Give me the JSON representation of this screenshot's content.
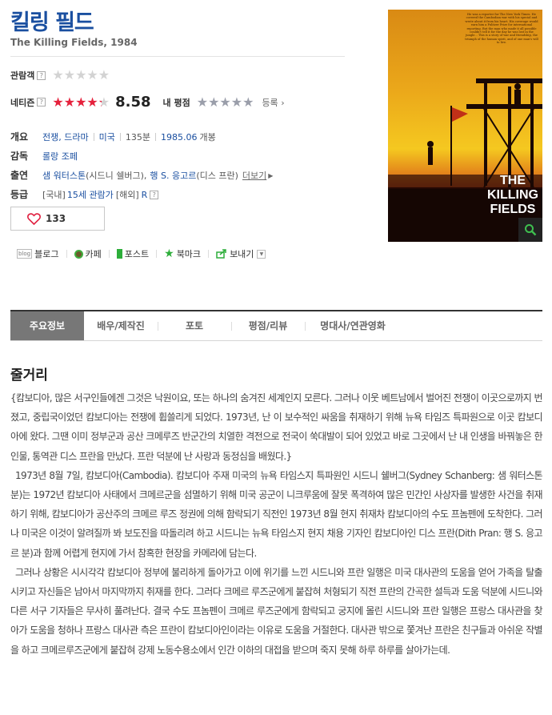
{
  "movie": {
    "title": "킬링 필드",
    "subtitle": "The Killing Fields, 1984"
  },
  "ratings": {
    "audience_label": "관람객",
    "audience_stars": 0,
    "netizen_label": "네티즌",
    "netizen_stars": 4.3,
    "netizen_score": "8.58",
    "my_label": "내 평점",
    "register_label": "등록"
  },
  "info": {
    "overview_label": "개요",
    "genre": "전쟁, 드라마",
    "country": "미국",
    "runtime": "135분",
    "release": "1985.06",
    "release_suffix": "개봉",
    "director_label": "감독",
    "director": "롤랑 조페",
    "cast_label": "출연",
    "cast1": "샘 워터스톤",
    "cast1_role": "(시드니 쉘버그),",
    "cast2": "행 S. 응고르",
    "cast2_role": "(디스 프란)",
    "more_label": "더보기",
    "grade_label": "등급",
    "grade_kr_prefix": "[국내]",
    "grade_kr": "15세 관람가",
    "grade_intl_prefix": "[해외]",
    "grade_intl": "R"
  },
  "like": {
    "count": "133"
  },
  "poster": {
    "quote": "He was a reporter for The New York Times. He covered the Cambodian war with his special and wrote about it from his heart. His coverage would earn him a Pulitzer Prize for international reporting. But the man who made it all possible couldn't tell it for the day he was lost in the jungle... This is a story of war and friendship, the triumph of the human spirit, and of one man's will to live.",
    "title_lines": [
      "THE",
      "KILLING",
      "FIELDS"
    ],
    "colors": {
      "sky_top": "#e8a81a",
      "sky_bottom": "#f3c61e",
      "horizon": "#c9461b"
    }
  },
  "share": {
    "blog": "블로그",
    "cafe": "카페",
    "post": "포스트",
    "bookmark": "북마크",
    "send": "보내기"
  },
  "tabs": [
    "주요정보",
    "배우/제작진",
    "포토",
    "평점/리뷰",
    "명대사/연관영화"
  ],
  "synopsis": {
    "title": "줄거리",
    "p1": "{캄보디아, 많은 서구인들에겐 그것은 낙원이요, 또는 하나의 숨겨진 세계인지 모른다. 그러나 이웃 베트남에서 벌어진 전쟁이 이곳으로까지 번졌고, 중립국이었던 캄보디아는 전쟁에 휩쓸리게 되었다. 1973년, 난 이 보수적인 싸움을 취재하기 위해 뉴욕 타임즈 특파원으로 이곳 캄보디아에 왔다. 그땐 이미 정부군과 공산 크메루즈 반군간의 치열한 격전으로 전국이 쑥대발이 되어 있었고 바로 그곳에서 난 내 인생을 바꿔놓은 한 인물, 통역관 디스 프란을 만났다. 프란 덕분에 난 사랑과 동정심을 배웠다.}",
    "p2": "1973년 8월 7일, 캄보디아(Cambodia). 캄보디아 주재 미국의 뉴욕 타임스지 특파원인 시드니 쉘버그(Sydney Schanberg: 샘 워터스톤 분)는 1972년 캄보디아 사태에서 크메르군을 섬멸하기 위해 미국 공군이 니크루움에 잘못 폭격하여 많은 민간인 사상자를 발생한 사건을 취재하기 위해, 캄보디아가 공산주의 크메르 루즈 정권에 의해 함락되기 직전인 1973년 8월 현지 취재차 캄보디아의 수도 프놈펜에 도착한다. 그러나 미국은 이것이 알려질까 봐 보도진을 따돌리려 하고 시드니는 뉴욕 타임스지 현지 채용 기자인 캄보디아인 디스 프란(Dith Pran: 행 S. 응고르 분)과 함께 어렵게 현지에 가서 참혹한 현장을 카메라에 담는다.",
    "p3": "그러나 상황은 시시각각 캄보디아 정부에 불리하게 돌아가고 이에 위기를 느낀 시드니와 프란 일행은 미국 대사관의 도움을 얻어 가족을 탈출시키고 자신들은 남아서 마지막까지 취재를 한다. 그러다 크메르 루즈군에게 붙잡혀 처형되기 직전 프란의 간곡한 설득과 도움 덕분에 시드니와 다른 서구 기자들은 무사히 풀려난다. 결국 수도 프놈펜이 크메르 루즈군에게 함락되고 궁지에 몰린 시드니와 프란 일행은 프랑스 대사관을 찾아가 도움을 청하나 프랑스 대사관 측은 프란이 캄보디아인이라는 이유로 도움을 거절한다. 대사관 밖으로 쫓겨난 프란은 친구들과 아쉬운 작별을 하고 크메르루즈군에게 붙잡혀 강제 노동수용소에서 인간 이하의 대접을 받으며 죽지 못해 하루 하루를 살아가는데."
  }
}
